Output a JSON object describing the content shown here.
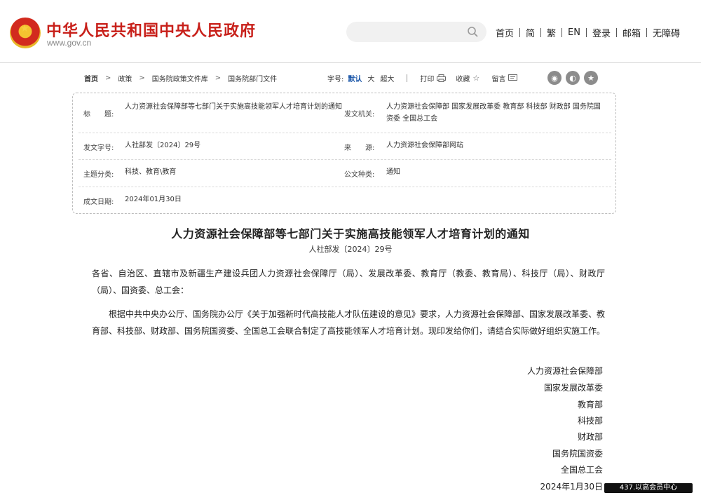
{
  "header": {
    "site_title": "中华人民共和国中央人民政府",
    "site_url": "www.gov.cn",
    "search": {
      "value": "",
      "placeholder": ""
    },
    "nav": [
      "首页",
      "简",
      "繁",
      "EN",
      "登录",
      "邮箱",
      "无障碍"
    ]
  },
  "breadcrumb": [
    "首页",
    "政策",
    "国务院政策文件库",
    "国务院部门文件"
  ],
  "tools": {
    "font_label": "字号:",
    "font_default": "默认",
    "font_large": "大",
    "font_xlarge": "超大",
    "print": "打印",
    "favorite": "收藏",
    "notes": "留言"
  },
  "share": [
    "weibo",
    "wechat",
    "favorite-star"
  ],
  "info": {
    "title_label": "标　　题:",
    "title_value": "人力资源社会保障部等七部门关于实施高技能领军人才培育计划的通知",
    "issuer_label": "发文机关:",
    "issuer_value": "人力资源社会保障部 国家发展改革委 教育部 科技部 财政部 国务院国资委 全国总工会",
    "docno_label": "发文字号:",
    "docno_value": "人社部发〔2024〕29号",
    "source_label": "来　　源:",
    "source_value": "人力资源社会保障部网站",
    "topic_label": "主题分类:",
    "topic_value": "科技、教育\\教育",
    "type_label": "公文种类:",
    "type_value": "通知",
    "date_label": "成文日期:",
    "date_value": "2024年01月30日"
  },
  "article": {
    "title": "人力资源社会保障部等七部门关于实施高技能领军人才培育计划的通知",
    "doc_no": "人社部发〔2024〕29号",
    "addressee": "各省、自治区、直辖市及新疆生产建设兵团人力资源社会保障厅（局）、发展改革委、教育厅（教委、教育局）、科技厅（局）、财政厅（局）、国资委、总工会：",
    "body": "根据中共中央办公厅、国务院办公厅《关于加强新时代高技能人才队伍建设的意见》要求，人力资源社会保障部、国家发展改革委、教育部、科技部、财政部、国务院国资委、全国总工会联合制定了高技能领军人才培育计划。现印发给你们，请结合实际做好组织实施工作。",
    "signatories": [
      "人力资源社会保障部",
      "国家发展改革委",
      "教育部",
      "科技部",
      "财政部",
      "国务院国资委",
      "全国总工会"
    ],
    "date": "2024年1月30日"
  },
  "floating_tag": "437.以高会员中心"
}
